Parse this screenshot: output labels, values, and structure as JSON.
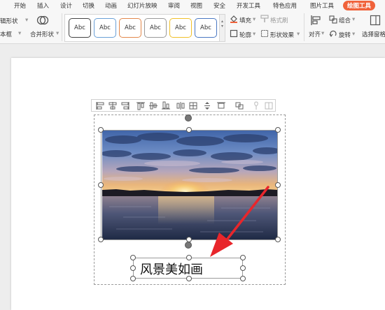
{
  "menubar": {
    "items": [
      "开始",
      "插入",
      "设计",
      "切换",
      "动画",
      "幻灯片放映",
      "审阅",
      "视图",
      "安全",
      "开发工具",
      "特色应用",
      "图片工具",
      "绘图工具"
    ],
    "active": "绘图工具"
  },
  "ribbon": {
    "edit_shape": "辑形状",
    "text_box": "本框",
    "merge_shapes": "合并形状",
    "style_label": "Abc",
    "fill": "填充",
    "format_painter": "格式刷",
    "outline": "轮廓",
    "shape_effects": "形状效果",
    "align": "对齐",
    "group": "组合",
    "rotate": "旋转",
    "select_pane": "选择窗格"
  },
  "slide": {
    "caption": "风景美如画"
  },
  "colors": {
    "accent": "#f0623a",
    "arrow": "#e8262b",
    "style_borders": [
      "#444444",
      "#6aa0d6",
      "#e2884b",
      "#9a9a9a",
      "#f0c029",
      "#4a78c2"
    ]
  }
}
